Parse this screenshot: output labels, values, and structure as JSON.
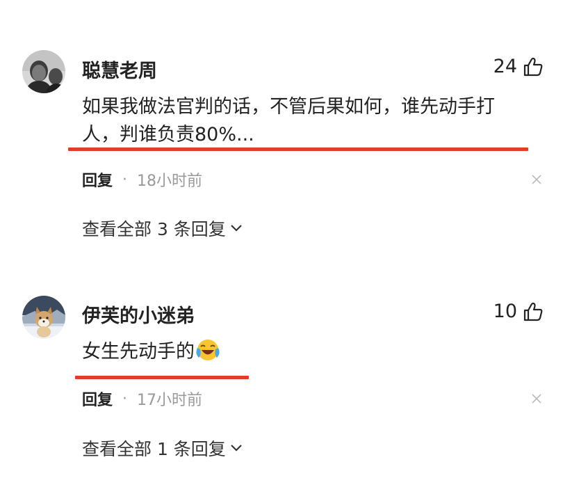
{
  "comments": [
    {
      "username": "聪慧老周",
      "likes": "24",
      "text": "如果我做法官判的话，不管后果如何，谁先动手打人，判谁负责80%...",
      "reply_label": "回复",
      "separator": "·",
      "time": "18小时前",
      "view_replies": "查看全部 3 条回复",
      "avatar_icon": "grayscale-man-photo",
      "highlight_color": "#e23b2a"
    },
    {
      "username": "伊芙的小迷弟",
      "likes": "10",
      "text": "女生先动手的",
      "emoji_icon": "laughing-crying-emoji",
      "reply_label": "回复",
      "separator": "·",
      "time": "17小时前",
      "view_replies": "查看全部 1 条回复",
      "avatar_icon": "shiba-dog-in-snow",
      "highlight_color": "#e23b2a"
    }
  ]
}
